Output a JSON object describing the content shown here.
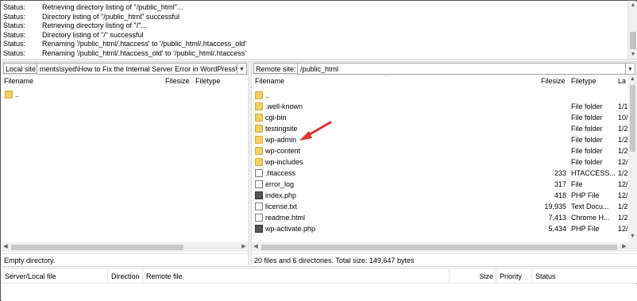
{
  "message_log": [
    {
      "label": "Status:",
      "text": "Retrieving directory listing of \"/public_html\"..."
    },
    {
      "label": "Status:",
      "text": "Directory listing of \"/public_html\" successful"
    },
    {
      "label": "Status:",
      "text": "Retrieving directory listing of \"/\"..."
    },
    {
      "label": "Status:",
      "text": "Directory listing of \"/\" successful"
    },
    {
      "label": "Status:",
      "text": "Renaming '/public_html/.htaccess' to '/public_html/.htaccess_old'"
    },
    {
      "label": "Status:",
      "text": "Renaming '/public_html/.htaccess_old' to '/public_html/.htaccess'"
    }
  ],
  "local": {
    "site_label": "Local site:",
    "path": "ments\\syed\\How to Fix the Internal Server Error in WordPress\\",
    "columns": {
      "filename": "Filename",
      "filesize": "Filesize",
      "filetype": "Filetype"
    },
    "files": [
      {
        "name": ".."
      }
    ],
    "status": "Empty directory."
  },
  "remote": {
    "site_label": "Remote site:",
    "path": "/public_html",
    "columns": {
      "filename": "Filename",
      "filesize": "Filesize",
      "filetype": "Filetype",
      "modified": "La"
    },
    "files": [
      {
        "name": "..",
        "icon": "folder-icon",
        "size": "",
        "type": "",
        "date": ""
      },
      {
        "name": ".well-known",
        "icon": "folder-icon",
        "size": "",
        "type": "File folder",
        "date": "1/1"
      },
      {
        "name": "cgi-bin",
        "icon": "folder-icon",
        "size": "",
        "type": "File folder",
        "date": "10/"
      },
      {
        "name": "testingsite",
        "icon": "folder-icon",
        "size": "",
        "type": "File folder",
        "date": "1/2"
      },
      {
        "name": "wp-admin",
        "icon": "folder-icon",
        "size": "",
        "type": "File folder",
        "date": "1/2"
      },
      {
        "name": "wp-content",
        "icon": "folder-icon",
        "size": "",
        "type": "File folder",
        "date": "1/2"
      },
      {
        "name": "wp-includes",
        "icon": "folder-icon",
        "size": "",
        "type": "File folder",
        "date": "12/"
      },
      {
        "name": ".htaccess",
        "icon": "file-icon",
        "size": "233",
        "type": "HTACCESS...",
        "date": "1/2"
      },
      {
        "name": "error_log",
        "icon": "file-icon",
        "size": "317",
        "type": "File",
        "date": "12/"
      },
      {
        "name": "index.php",
        "icon": "php-file-icon",
        "size": "418",
        "type": "PHP File",
        "date": "12/"
      },
      {
        "name": "license.txt",
        "icon": "file-icon",
        "size": "19,935",
        "type": "Text Docu...",
        "date": "1/2"
      },
      {
        "name": "readme.html",
        "icon": "file-icon",
        "size": "7,413",
        "type": "Chrome H...",
        "date": "1/2"
      },
      {
        "name": "wp-activate.php",
        "icon": "php-file-icon",
        "size": "5,434",
        "type": "PHP File",
        "date": "12/"
      }
    ],
    "status": "20 files and 6 directories. Total size: 149,647 bytes"
  },
  "queue": {
    "columns": {
      "server_local_file": "Server/Local file",
      "direction": "Direction",
      "remote_file": "Remote file",
      "size": "Size",
      "priority": "Priority",
      "status": "Status"
    }
  },
  "annotation": {
    "color": "#e0322c",
    "points_to": "wp-admin"
  }
}
